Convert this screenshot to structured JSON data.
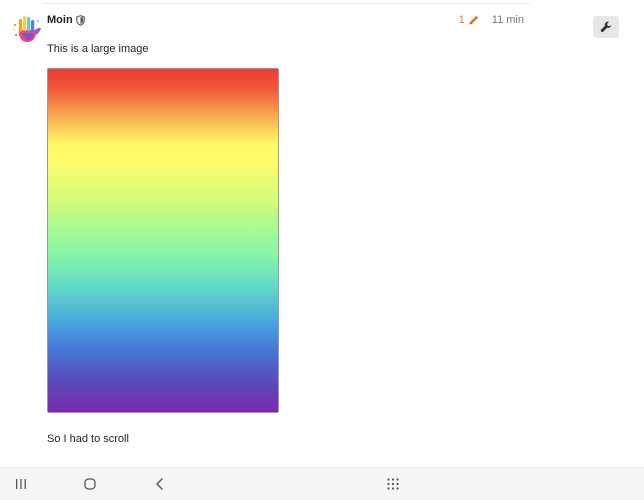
{
  "post": {
    "author": {
      "name": "Moin",
      "avatar_icon": "hand-avatar-icon",
      "role_icon": "shield-icon"
    },
    "meta": {
      "edit_count": "1",
      "edit_icon": "pencil-icon",
      "timestamp": "11 min",
      "accent_color": "#e07f25"
    },
    "body": {
      "text_before_image": "This is a large image",
      "text_after_image": "So I had to scroll"
    },
    "admin_icon": "wrench-icon"
  },
  "nav_bar": {
    "buttons": [
      {
        "icon": "recents-icon"
      },
      {
        "icon": "home-icon"
      },
      {
        "icon": "back-icon"
      },
      {
        "icon": "app-grid-icon"
      }
    ]
  }
}
